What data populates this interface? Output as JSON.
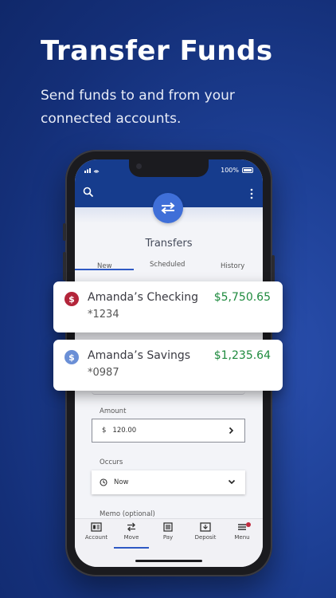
{
  "promo": {
    "headline": "Transfer Funds",
    "subline_1": "Send funds to and from your",
    "subline_2": "connected accounts."
  },
  "statusbar": {
    "battery": "100%"
  },
  "screen": {
    "title": "Transfers",
    "tabs": [
      {
        "label": "New",
        "active": true
      },
      {
        "label": "Scheduled",
        "active": false
      },
      {
        "label": "History",
        "active": false
      }
    ]
  },
  "form": {
    "amount_label": "Amount",
    "amount_currency": "$",
    "amount_value": "120.00",
    "occurs_label": "Occurs",
    "occurs_value": "Now",
    "memo_label": "Memo (optional)"
  },
  "accounts": [
    {
      "name": "Amanda’s Checking",
      "number": "*1234",
      "balance": "$5,750.65",
      "icon_color": "#b3253a"
    },
    {
      "name": "Amanda’s Savings",
      "number": "*0987",
      "balance": "$1,235.64",
      "icon_color": "#6a8fd6"
    }
  ],
  "nav": [
    {
      "label": "Account",
      "icon": "account-card-icon"
    },
    {
      "label": "Move",
      "icon": "transfer-arrows-icon",
      "active": true
    },
    {
      "label": "Pay",
      "icon": "bill-icon"
    },
    {
      "label": "Deposit",
      "icon": "deposit-icon"
    },
    {
      "label": "Menu",
      "icon": "menu-icon",
      "badge": true
    }
  ],
  "colors": {
    "brand_blue": "#163c8d",
    "accent": "#3f6fd8",
    "positive": "#1e8a3e",
    "alert": "#c02a3e"
  }
}
